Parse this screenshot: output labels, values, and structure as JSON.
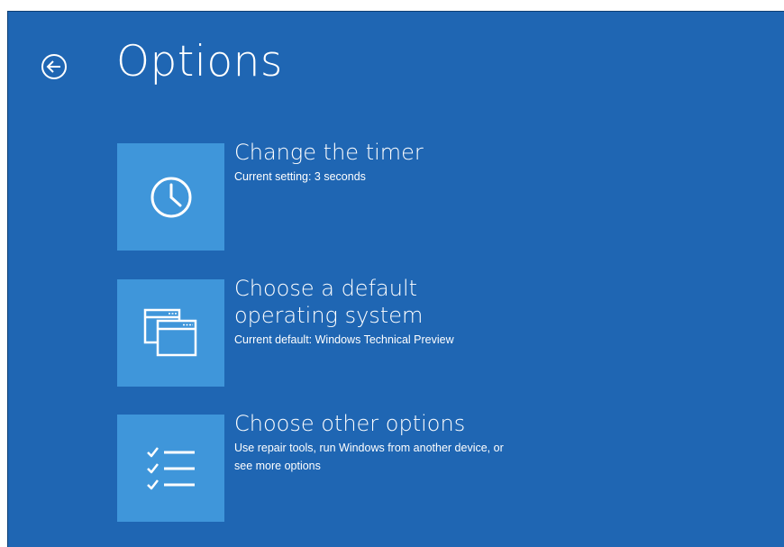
{
  "page": {
    "title": "Options",
    "back_icon": "back-arrow-circle-icon"
  },
  "colors": {
    "background": "#1f66b3",
    "tile": "#3f96da",
    "text": "#ffffff"
  },
  "options": [
    {
      "icon": "clock-icon",
      "title": "Change the timer",
      "description": "Current setting: 3 seconds"
    },
    {
      "icon": "windows-stack-icon",
      "title": "Choose a default operating system",
      "description": "Current default: Windows Technical Preview"
    },
    {
      "icon": "checklist-icon",
      "title": "Choose other options",
      "description": "Use repair tools, run Windows from another device, or see more options"
    }
  ]
}
